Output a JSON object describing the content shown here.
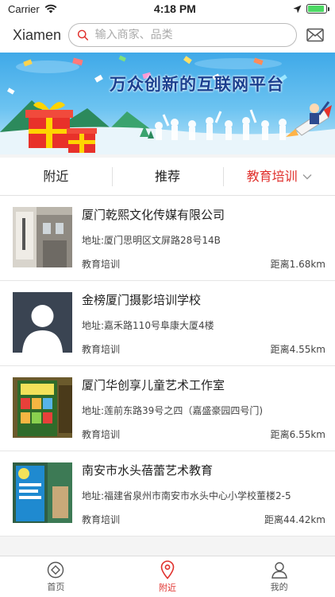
{
  "status_bar": {
    "carrier": "Carrier",
    "time": "4:18 PM",
    "battery_level": 0.9
  },
  "header": {
    "city": "Xiamen",
    "search_placeholder": "输入商家、品类",
    "icons": [
      "search-icon",
      "mail-icon"
    ]
  },
  "banner": {
    "title": "万众创新的互联网平台"
  },
  "tabs": [
    {
      "label": "附近",
      "active": false
    },
    {
      "label": "推荐",
      "active": false
    },
    {
      "label": "教育培训",
      "active": true,
      "icon": "chevron-down-icon"
    }
  ],
  "listings": [
    {
      "name": "厦门乾熙文化传媒有限公司",
      "address": "地址:厦门思明区文屏路28号14B",
      "category": "教育培训",
      "distance": "距离1.68km"
    },
    {
      "name": "金榜厦门摄影培训学校",
      "address": "地址:嘉禾路110号阜康大厦4楼",
      "category": "教育培训",
      "distance": "距离4.55km"
    },
    {
      "name": "厦门华创享儿童艺术工作室",
      "address": "地址:莲前东路39号之四（嘉盛豪园四号门)",
      "category": "教育培训",
      "distance": "距离6.55km"
    },
    {
      "name": "南安市水头蓓蕾艺术教育",
      "address": "地址:福建省泉州市南安市水头中心小学校董楼2-5",
      "category": "教育培训",
      "distance": "距离44.42km"
    }
  ],
  "bottom_nav": [
    {
      "label": "首页",
      "icon": "home-diamond-icon",
      "active": false
    },
    {
      "label": "附近",
      "icon": "location-pin-icon",
      "active": true
    },
    {
      "label": "我的",
      "icon": "person-icon",
      "active": false
    }
  ],
  "colors": {
    "accent": "#e0302c",
    "banner_title": "#1a3f8f"
  }
}
